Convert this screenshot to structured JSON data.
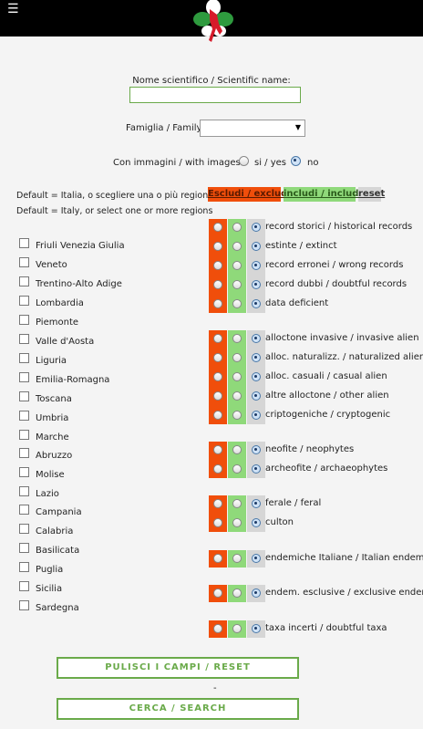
{
  "menu_icon": "hamburger-icon",
  "logo_icon": "italy-flower-logo",
  "search": {
    "scientific_name_label": "Nome scientifico / Scientific name:",
    "scientific_name_value": "",
    "family_label": "Famiglia / Family:",
    "family_value": "",
    "images_label": "Con immagini / with images:",
    "images_yes": "si / yes",
    "images_no": "no",
    "images_selected": "no"
  },
  "regions_hint": {
    "line1": "Default = Italia, o scegliere una o più regioni",
    "line2": "Default = Italy, or select one or more regions"
  },
  "filter_headers": {
    "exclude": "Escludi / exclude",
    "include": "includi / include",
    "reset": "reset"
  },
  "colors": {
    "exclude": "#f04e0b",
    "include": "#8fd97a",
    "reset": "#d6d6d6",
    "accent_green": "#6aaa4a"
  },
  "regions": [
    "Friuli Venezia Giulia",
    "Veneto",
    "Trentino-Alto Adige",
    "Lombardia",
    "Piemonte",
    "Valle d'Aosta",
    "Liguria",
    "Emilia-Romagna",
    "Toscana",
    "Umbria",
    "Marche",
    "Abruzzo",
    "Molise",
    "Lazio",
    "Campania",
    "Calabria",
    "Basilicata",
    "Puglia",
    "Sicilia",
    "Sardegna"
  ],
  "filters": [
    {
      "label": "record storici / historical records",
      "selected": "reset"
    },
    {
      "label": "estinte / extinct",
      "selected": "reset"
    },
    {
      "label": "record erronei / wrong records",
      "selected": "reset"
    },
    {
      "label": "record dubbi / doubtful records",
      "selected": "reset"
    },
    {
      "label": "data deficient",
      "selected": "reset"
    },
    {
      "label": "alloctone invasive / invasive alien",
      "selected": "reset"
    },
    {
      "label": "alloc. naturalizz. / naturalized alien",
      "selected": "reset"
    },
    {
      "label": "alloc. casuali / casual alien",
      "selected": "reset"
    },
    {
      "label": "altre alloctone / other alien",
      "selected": "reset"
    },
    {
      "label": "criptogeniche / cryptogenic",
      "selected": "reset"
    },
    {
      "label": "neofite / neophytes",
      "selected": "reset"
    },
    {
      "label": "archeofite / archaeophytes",
      "selected": "reset"
    },
    {
      "label": "ferale / feral",
      "selected": "reset"
    },
    {
      "label": "culton",
      "selected": "reset"
    },
    {
      "label": "endemiche Italiane / Italian endemic",
      "selected": "reset"
    },
    {
      "label": "endem. esclusive / exclusive endem.",
      "selected": "reset"
    },
    {
      "label": "taxa incerti / doubtful taxa",
      "selected": "reset"
    }
  ],
  "buttons": {
    "reset": "PULISCI I CAMPI / RESET",
    "separator": "-",
    "search": "CERCA / SEARCH"
  }
}
